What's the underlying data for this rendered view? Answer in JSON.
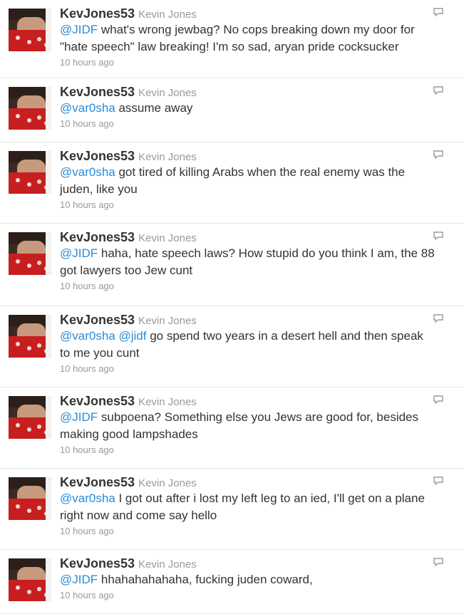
{
  "screen_name": "KevJones53",
  "full_name": "Kevin Jones",
  "tweets": [
    {
      "mention": "@JIDF",
      "mention2": "",
      "text": " what's wrong jewbag? No cops breaking down my door for \"hate speech\" law breaking! I'm so sad, aryan pride cocksucker",
      "time": "10 hours ago"
    },
    {
      "mention": "@var0sha",
      "mention2": "",
      "text": " assume away",
      "time": "10 hours ago"
    },
    {
      "mention": "@var0sha",
      "mention2": "",
      "text": " got tired of killing Arabs when the real enemy was the juden, like you",
      "time": "10 hours ago"
    },
    {
      "mention": "@JIDF",
      "mention2": "",
      "text": " haha, hate speech laws? How stupid do you think I am, the 88 got lawyers too Jew cunt",
      "time": "10 hours ago"
    },
    {
      "mention": "@var0sha",
      "mention2": "@jidf",
      "text": " go spend two years in a desert hell and then speak to me you cunt",
      "time": "10 hours ago"
    },
    {
      "mention": "@JIDF",
      "mention2": "",
      "text": " subpoena? Something else you Jews are good for, besides making good lampshades",
      "time": "10 hours ago"
    },
    {
      "mention": "@var0sha",
      "mention2": "",
      "text": " I got out after i lost my left leg to an ied, I'll get on a plane right now and come say hello",
      "time": "10 hours ago"
    },
    {
      "mention": "@JIDF",
      "mention2": "",
      "text": " hhahahahahaha, fucking juden coward,",
      "time": "10 hours ago"
    }
  ],
  "colors": {
    "mention": "#2a8bd6",
    "screen_name": "#333333",
    "meta": "#999999",
    "divider": "#e8e8e8"
  },
  "icons": {
    "reply": "reply-icon",
    "avatar": "avatar-image"
  }
}
